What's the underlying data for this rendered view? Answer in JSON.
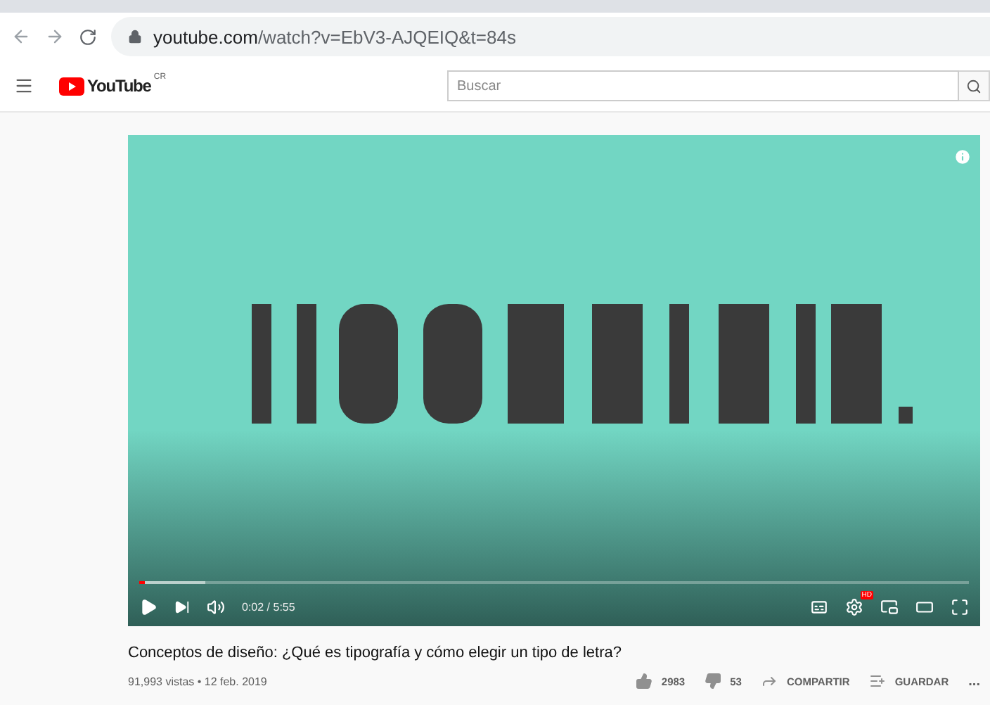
{
  "browser": {
    "url_host": "youtube.com",
    "url_path": "/watch?v=EbV3-AJQEIQ&t=84s"
  },
  "header": {
    "logo_text": "YouTube",
    "region": "CR",
    "search": {
      "placeholder": "Buscar"
    }
  },
  "player": {
    "progress": {
      "level": 0.006
    },
    "time": "0:02 / 5:55",
    "hd": "HD"
  },
  "video": {
    "title": "Conceptos de diseño: ¿Qué es tipografía y cómo elegir un tipo de letra?",
    "meta": "91,993 vistas • 12 feb. 2019",
    "actions": [
      {
        "kind": "like",
        "label": "2983"
      },
      {
        "kind": "dislike",
        "label": "53"
      },
      {
        "kind": "share",
        "label": "COMPARTIR"
      },
      {
        "kind": "save",
        "label": "GUARDAR"
      },
      {
        "kind": "more",
        "label": "..."
      }
    ]
  }
}
